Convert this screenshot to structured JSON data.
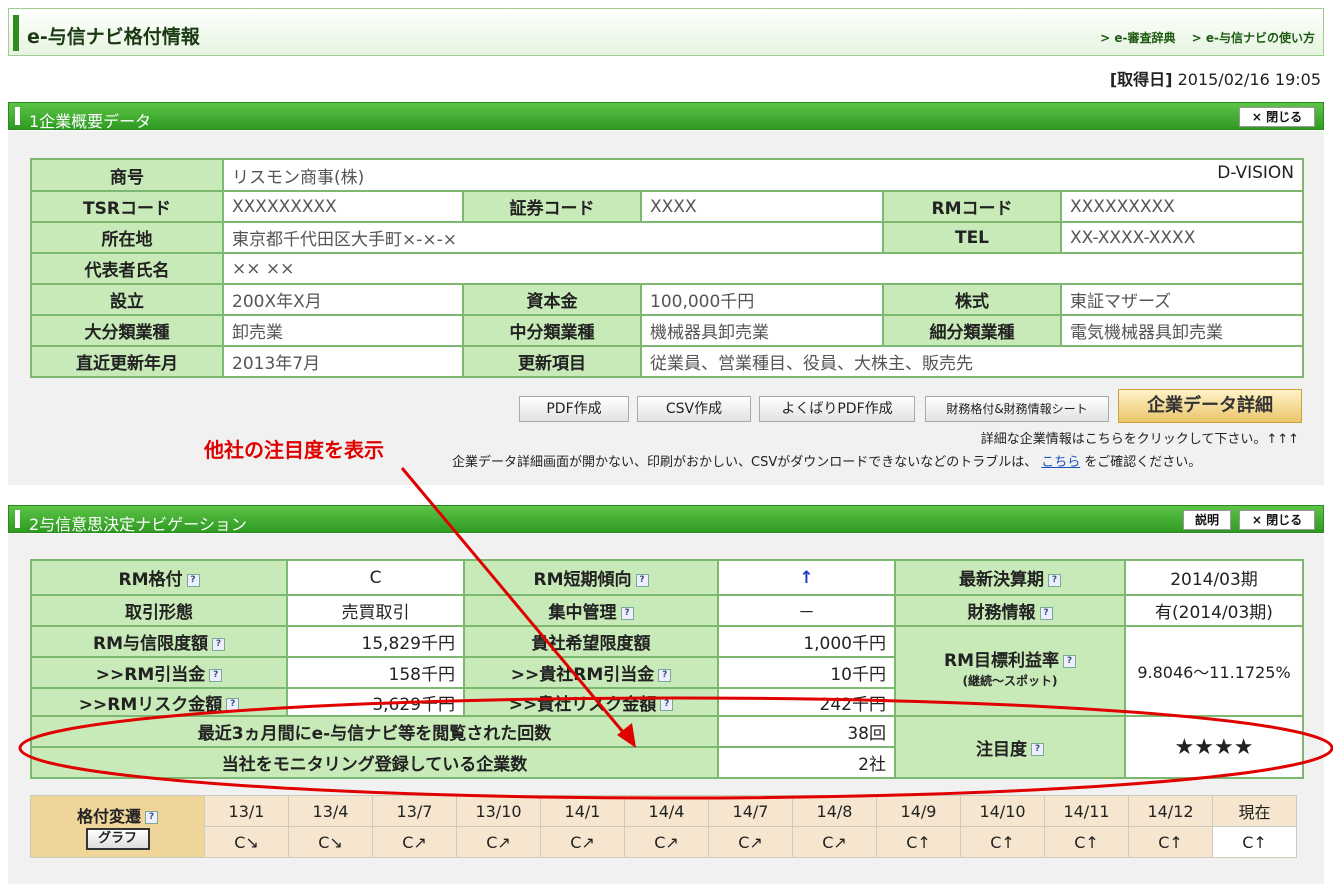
{
  "header": {
    "title": "e-与信ナビ格付情報",
    "links": [
      "> e-審査辞典",
      "> e-与信ナビの使い方"
    ]
  },
  "acquired": {
    "label": "[取得日]",
    "value": "2015/02/16 19:05"
  },
  "section1": {
    "title": "1企業概要データ",
    "close": "× 閉じる"
  },
  "company": {
    "shogo_label": "商号",
    "shogo": "リスモン商事(株)",
    "dvision": "D-VISION",
    "tsr_label": "TSRコード",
    "tsr": "XXXXXXXXX",
    "sec_label": "証券コード",
    "sec": "XXXX",
    "rm_label": "RMコード",
    "rm": "XXXXXXXXX",
    "addr_label": "所在地",
    "addr": "東京都千代田区大手町×-×-×",
    "tel_label": "TEL",
    "tel": "XX-XXXX-XXXX",
    "rep_label": "代表者氏名",
    "rep": "×× ××",
    "est_label": "設立",
    "est": "200X年X月",
    "cap_label": "資本金",
    "cap": "100,000千円",
    "stock_label": "株式",
    "stock": "東証マザーズ",
    "ind1_label": "大分類業種",
    "ind1": "卸売業",
    "ind2_label": "中分類業種",
    "ind2": "機械器具卸売業",
    "ind3_label": "細分類業種",
    "ind3": "電気機械器具卸売業",
    "upd_label": "直近更新年月",
    "upd": "2013年7月",
    "upditem_label": "更新項目",
    "upditem": "従業員、営業種目、役員、大株主、販売先"
  },
  "buttons": {
    "pdf": "PDF作成",
    "csv": "CSV作成",
    "yokubari": "よくばりPDF作成",
    "zaimu": "財務格付&財務情報シート",
    "detail": "企業データ詳細"
  },
  "notes": {
    "detail": "詳細な企業情報はこちらをクリックして下さい。↑↑↑",
    "trouble_pre": "企業データ詳細画面が開かない、印刷がおかしい、CSVがダウンロードできないなどのトラブルは、",
    "trouble_link": "こちら",
    "trouble_post": "をご確認ください。"
  },
  "annotation": "他社の注目度を表示",
  "section2": {
    "title": "2与信意思決定ナビゲーション",
    "explain": "説明",
    "close": "× 閉じる"
  },
  "nav": {
    "rm_rating_label": "RM格付",
    "rm_rating": "C",
    "rm_trend_label": "RM短期傾向",
    "rm_trend": "↑",
    "latest_label": "最新決算期",
    "latest": "2014/03期",
    "deal_label": "取引形態",
    "deal": "売買取引",
    "central_label": "集中管理",
    "central": "－",
    "fin_label": "財務情報",
    "fin": "有(2014/03期)",
    "limit_label": "RM与信限度額",
    "limit": "15,829千円",
    "wish_label": "貴社希望限度額",
    "wish": "1,000千円",
    "alloc_label": ">>RM引当金",
    "alloc": "158千円",
    "galloc_label": ">>貴社RM引当金",
    "galloc": "10千円",
    "risk_label": ">>RMリスク金額",
    "risk": "3,629千円",
    "grisk_label": ">>貴社リスク金額",
    "grisk": "242千円",
    "target_label": "RM目標利益率",
    "target_sub": "(継続～スポット)",
    "target": "9.8046～11.1725%",
    "views_label": "最近3ヵ月間にe-与信ナビ等を閲覧された回数",
    "views": "38回",
    "monitor_label": "当社をモニタリング登録している企業数",
    "monitor": "2社",
    "attention_label": "注目度",
    "attention": "★★★★"
  },
  "history": {
    "label": "格付変遷",
    "graph": "グラフ",
    "periods": [
      "13/1",
      "13/4",
      "13/7",
      "13/10",
      "14/1",
      "14/4",
      "14/7",
      "14/8",
      "14/9",
      "14/10",
      "14/11",
      "14/12",
      "現在"
    ],
    "ratings": [
      "C↘",
      "C↘",
      "C↗",
      "C↗",
      "C↗",
      "C↗",
      "C↗",
      "C↗",
      "C↑",
      "C↑",
      "C↑",
      "C↑",
      "C↑"
    ]
  }
}
